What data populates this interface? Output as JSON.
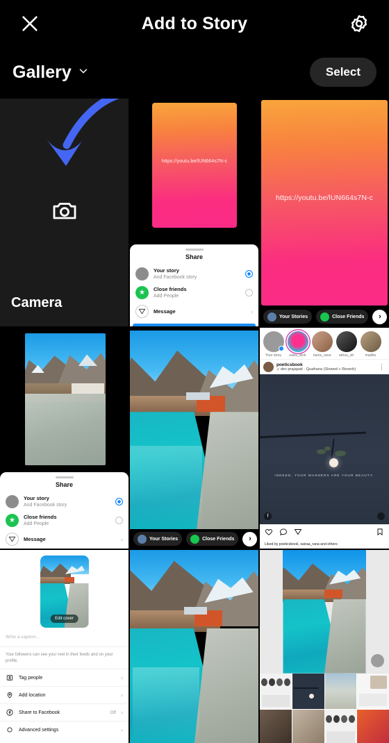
{
  "header": {
    "title": "Add to Story",
    "close_icon": "close-icon",
    "settings_icon": "settings-gear-icon"
  },
  "toolbar": {
    "gallery_label": "Gallery",
    "gallery_chevron": "chevron-down-icon",
    "select_label": "Select"
  },
  "camera_tile": {
    "label": "Camera",
    "icon": "camera-icon",
    "annotation": "blue-curved-arrow"
  },
  "story_bar": {
    "your_stories": "Your Stories",
    "close_friends": "Close Friends",
    "next_arrow": "›"
  },
  "share_sheet": {
    "title": "Share",
    "rows": [
      {
        "title": "Your story",
        "subtitle": "And Facebook story",
        "control": "radio-selected"
      },
      {
        "title": "Close friends",
        "subtitle": "Add People",
        "control": "radio-empty"
      },
      {
        "title": "Message",
        "subtitle": "",
        "control": "chevron"
      }
    ]
  },
  "gradient_story": {
    "url_text": "https://youtu.be/lUN664s7N-c",
    "color_top": "#F9A53C",
    "color_bottom": "#FB2B86"
  },
  "feed_screenshot": {
    "stories": [
      {
        "name": "Your story",
        "ring": false,
        "badge": true
      },
      {
        "name": "saira_click",
        "ring": true,
        "badge": false
      },
      {
        "name": "nains_rana",
        "ring": false,
        "badge": false
      },
      {
        "name": "rahuu_sh",
        "ring": false,
        "badge": false
      },
      {
        "name": "madhu",
        "ring": false,
        "badge": false
      }
    ],
    "post": {
      "username": "poeticsbook",
      "music": "♫ dev prajapati · Quafrana (Slowed + Reverb)",
      "quote": "INDEED, YOUR MANNERS ARE YOUR BEAUTY.",
      "actions": [
        "like-heart-icon",
        "comment-bubble-icon",
        "share-paperplane-icon",
        "bookmark-icon"
      ],
      "likes_text": "Liked by poeticsbook, sairaa_rana and others"
    }
  },
  "reel_sheet": {
    "edit_cover": "Edit cover",
    "caption_placeholder": "Write a caption...",
    "followers_note": "Your followers can see your reel in their feeds and on your profile.",
    "options": [
      {
        "label": "Tag people",
        "icon": "tag-people-icon",
        "value": ""
      },
      {
        "label": "Add location",
        "icon": "location-pin-icon",
        "value": ""
      },
      {
        "label": "Share to Facebook",
        "icon": "facebook-icon",
        "value": "Off"
      },
      {
        "label": "Advanced settings",
        "icon": "settings-gear-icon",
        "value": ""
      }
    ]
  },
  "colors": {
    "background": "#000000",
    "select_button": "#262626",
    "annotation_arrow": "#4466F2",
    "accent_blue": "#0A84FF",
    "close_friends_green": "#18C74F"
  }
}
